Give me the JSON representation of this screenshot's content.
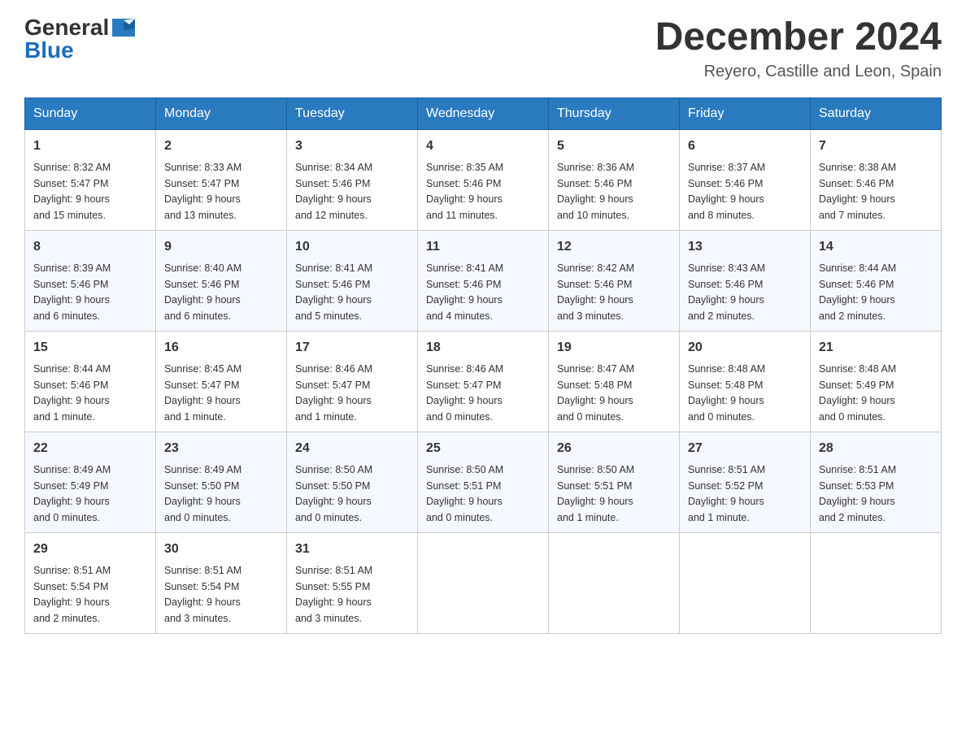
{
  "header": {
    "logo_general": "General",
    "logo_blue": "Blue",
    "month_title": "December 2024",
    "location": "Reyero, Castille and Leon, Spain"
  },
  "days_of_week": [
    "Sunday",
    "Monday",
    "Tuesday",
    "Wednesday",
    "Thursday",
    "Friday",
    "Saturday"
  ],
  "weeks": [
    [
      {
        "day": "1",
        "sunrise": "8:32 AM",
        "sunset": "5:47 PM",
        "daylight": "9 hours and 15 minutes."
      },
      {
        "day": "2",
        "sunrise": "8:33 AM",
        "sunset": "5:47 PM",
        "daylight": "9 hours and 13 minutes."
      },
      {
        "day": "3",
        "sunrise": "8:34 AM",
        "sunset": "5:46 PM",
        "daylight": "9 hours and 12 minutes."
      },
      {
        "day": "4",
        "sunrise": "8:35 AM",
        "sunset": "5:46 PM",
        "daylight": "9 hours and 11 minutes."
      },
      {
        "day": "5",
        "sunrise": "8:36 AM",
        "sunset": "5:46 PM",
        "daylight": "9 hours and 10 minutes."
      },
      {
        "day": "6",
        "sunrise": "8:37 AM",
        "sunset": "5:46 PM",
        "daylight": "9 hours and 8 minutes."
      },
      {
        "day": "7",
        "sunrise": "8:38 AM",
        "sunset": "5:46 PM",
        "daylight": "9 hours and 7 minutes."
      }
    ],
    [
      {
        "day": "8",
        "sunrise": "8:39 AM",
        "sunset": "5:46 PM",
        "daylight": "9 hours and 6 minutes."
      },
      {
        "day": "9",
        "sunrise": "8:40 AM",
        "sunset": "5:46 PM",
        "daylight": "9 hours and 6 minutes."
      },
      {
        "day": "10",
        "sunrise": "8:41 AM",
        "sunset": "5:46 PM",
        "daylight": "9 hours and 5 minutes."
      },
      {
        "day": "11",
        "sunrise": "8:41 AM",
        "sunset": "5:46 PM",
        "daylight": "9 hours and 4 minutes."
      },
      {
        "day": "12",
        "sunrise": "8:42 AM",
        "sunset": "5:46 PM",
        "daylight": "9 hours and 3 minutes."
      },
      {
        "day": "13",
        "sunrise": "8:43 AM",
        "sunset": "5:46 PM",
        "daylight": "9 hours and 2 minutes."
      },
      {
        "day": "14",
        "sunrise": "8:44 AM",
        "sunset": "5:46 PM",
        "daylight": "9 hours and 2 minutes."
      }
    ],
    [
      {
        "day": "15",
        "sunrise": "8:44 AM",
        "sunset": "5:46 PM",
        "daylight": "9 hours and 1 minute."
      },
      {
        "day": "16",
        "sunrise": "8:45 AM",
        "sunset": "5:47 PM",
        "daylight": "9 hours and 1 minute."
      },
      {
        "day": "17",
        "sunrise": "8:46 AM",
        "sunset": "5:47 PM",
        "daylight": "9 hours and 1 minute."
      },
      {
        "day": "18",
        "sunrise": "8:46 AM",
        "sunset": "5:47 PM",
        "daylight": "9 hours and 0 minutes."
      },
      {
        "day": "19",
        "sunrise": "8:47 AM",
        "sunset": "5:48 PM",
        "daylight": "9 hours and 0 minutes."
      },
      {
        "day": "20",
        "sunrise": "8:48 AM",
        "sunset": "5:48 PM",
        "daylight": "9 hours and 0 minutes."
      },
      {
        "day": "21",
        "sunrise": "8:48 AM",
        "sunset": "5:49 PM",
        "daylight": "9 hours and 0 minutes."
      }
    ],
    [
      {
        "day": "22",
        "sunrise": "8:49 AM",
        "sunset": "5:49 PM",
        "daylight": "9 hours and 0 minutes."
      },
      {
        "day": "23",
        "sunrise": "8:49 AM",
        "sunset": "5:50 PM",
        "daylight": "9 hours and 0 minutes."
      },
      {
        "day": "24",
        "sunrise": "8:50 AM",
        "sunset": "5:50 PM",
        "daylight": "9 hours and 0 minutes."
      },
      {
        "day": "25",
        "sunrise": "8:50 AM",
        "sunset": "5:51 PM",
        "daylight": "9 hours and 0 minutes."
      },
      {
        "day": "26",
        "sunrise": "8:50 AM",
        "sunset": "5:51 PM",
        "daylight": "9 hours and 1 minute."
      },
      {
        "day": "27",
        "sunrise": "8:51 AM",
        "sunset": "5:52 PM",
        "daylight": "9 hours and 1 minute."
      },
      {
        "day": "28",
        "sunrise": "8:51 AM",
        "sunset": "5:53 PM",
        "daylight": "9 hours and 2 minutes."
      }
    ],
    [
      {
        "day": "29",
        "sunrise": "8:51 AM",
        "sunset": "5:54 PM",
        "daylight": "9 hours and 2 minutes."
      },
      {
        "day": "30",
        "sunrise": "8:51 AM",
        "sunset": "5:54 PM",
        "daylight": "9 hours and 3 minutes."
      },
      {
        "day": "31",
        "sunrise": "8:51 AM",
        "sunset": "5:55 PM",
        "daylight": "9 hours and 3 minutes."
      },
      null,
      null,
      null,
      null
    ]
  ],
  "labels": {
    "sunrise": "Sunrise:",
    "sunset": "Sunset:",
    "daylight": "Daylight:"
  }
}
